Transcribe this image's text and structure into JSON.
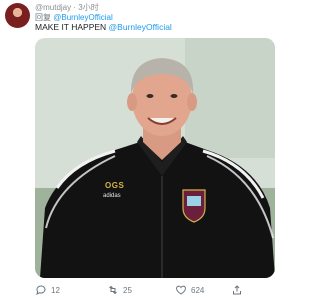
{
  "tweet": {
    "author_handle": "@mutdjay",
    "time_ago": "3小时",
    "reply_prefix": "回复",
    "reply_handle": "@BurnleyOfficial",
    "text_main": "MAKE IT HAPPEN",
    "text_mention": "@BurnleyOfficial",
    "photo_jersey_text": "OGS",
    "photo_brand_text": "adidas"
  },
  "actions": {
    "replies": "12",
    "retweets": "25",
    "likes": "624"
  },
  "icons": [
    "avatar",
    "reply-icon",
    "retweet-icon",
    "like-icon",
    "share-icon"
  ],
  "colors": {
    "link": "#1d9bf0",
    "muted": "#6b7580"
  }
}
